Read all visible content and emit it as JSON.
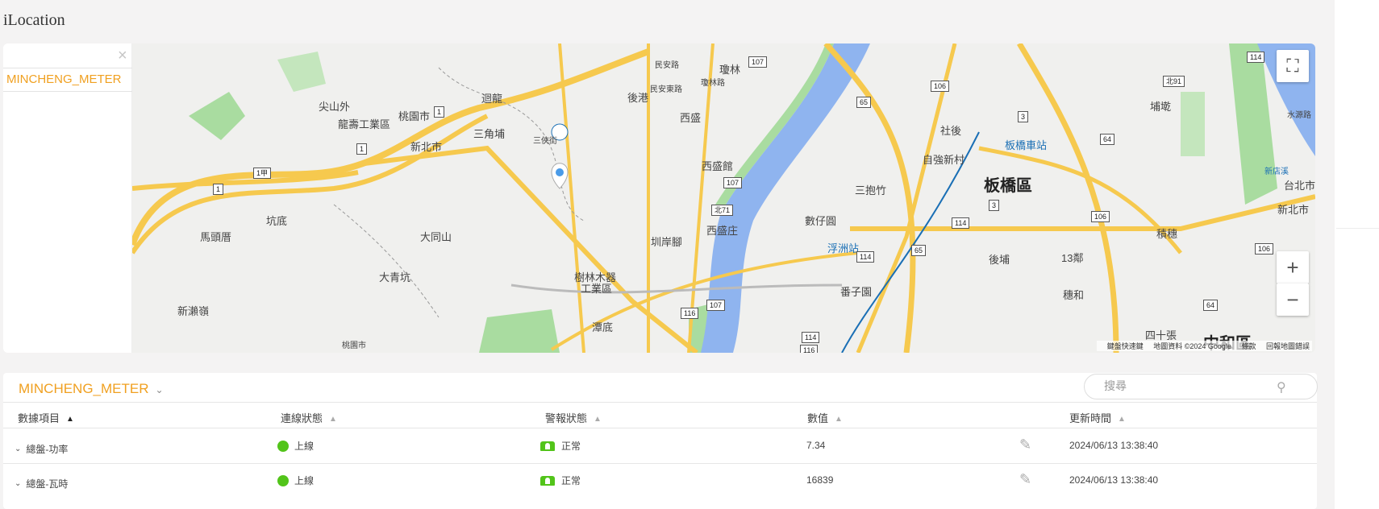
{
  "app": {
    "title": "iLocation"
  },
  "panel": {
    "close_symbol": "×",
    "device": "MINCHENG_METER"
  },
  "map": {
    "labels": {
      "jianshanwai": "尖山外",
      "longshou": "龍壽工業區",
      "taoyuan": "桃園市",
      "xinbei": "新北市",
      "huilong": "迴龍",
      "sanjiaopu": "三角埔",
      "sanying": "三俠街",
      "kengdi": "坑底",
      "matoucuo": "馬頭厝",
      "datongshan": "大同山",
      "daqingkeng": "大青坑",
      "xinchaoling": "新瀨嶺",
      "taoyuan2": "桃園市",
      "lintoulu": "民安路",
      "minlu": "民安東路",
      "qionglin": "瓊林",
      "qiongzilu": "瓊林路",
      "xigang": "後港",
      "xisheng": "西盛",
      "xishengguan": "西盛館",
      "xishengzhuang": "西盛庄",
      "pinganjiao": "圳岸腳",
      "shulin": "樹林木器",
      "shulin2": "工業區",
      "tandi": "潭底",
      "sheshang": "社後",
      "ziqiang": "自強新村",
      "banqiao_station": "板橋車站",
      "banqiao": "板橋區",
      "sanbaozhu": "三抱竹",
      "shuzaiyuan": "數仔圓",
      "fuzhou": "浮洲站",
      "fanzi": "番子園",
      "houpu": "後埔",
      "pubi": "埔墘",
      "jiwei": "積穗",
      "shisan": "13鄰",
      "suihe": "穗和",
      "sijia": "四十張",
      "zhonghe": "中和區",
      "xinbei2": "新北市",
      "taipei": "台北市",
      "xindian": "新店溪",
      "shuiyuan": "水源路"
    },
    "shields": {
      "r1a": "1",
      "r1b": "1",
      "r1c": "1甲",
      "r1d": "1",
      "r107a": "107",
      "r107b": "107",
      "r107c": "107",
      "r106a": "106",
      "r106b": "106",
      "r106c": "106",
      "r65a": "65",
      "r65b": "65",
      "r64a": "64",
      "r64b": "64",
      "r114a": "114",
      "r114b": "114",
      "r114c": "114",
      "r114d": "114",
      "r116a": "116",
      "r116b": "116",
      "r3a": "3",
      "r3b": "3",
      "r71": "北71",
      "r91": "北91"
    },
    "attribution": {
      "shortcuts": "鍵盤快速鍵",
      "data": "地圖資料 ©2024 Google",
      "terms": "條款",
      "report": "回報地圖錯誤"
    },
    "controls": {
      "fullscreen": "⛶",
      "zoom_in": "+",
      "zoom_out": "−"
    },
    "colors": {
      "water": "#8fb4ef",
      "park": "#a9dca0",
      "road": "#f6c94e",
      "rail": "#1a6fb5"
    }
  },
  "table": {
    "device_select": "MINCHENG_METER",
    "search": {
      "placeholder": "搜尋"
    },
    "headers": [
      "數據項目",
      "連線狀態",
      "警報狀態",
      "數值",
      "更新時間"
    ],
    "rows": [
      {
        "item": "總盤-功率",
        "connection": "上線",
        "alarm": "正常",
        "value": "7.34",
        "updated": "2024/06/13 13:38:40"
      },
      {
        "item": "總盤-瓦時",
        "connection": "上線",
        "alarm": "正常",
        "value": "16839",
        "updated": "2024/06/13 13:38:40"
      }
    ],
    "status_colors": {
      "online": "#52c41a",
      "alarm_normal": "#52c41a"
    }
  }
}
